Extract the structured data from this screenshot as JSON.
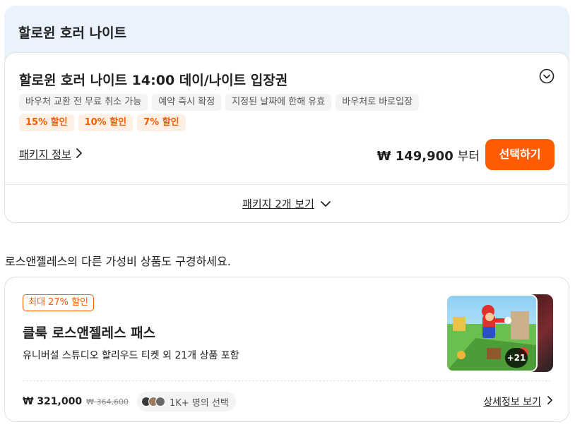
{
  "section": {
    "title": "할로윈 호러 나이트"
  },
  "package": {
    "title": "할로윈 호러 나이트 14:00 데이/나이트 입장권",
    "info_tags": [
      "바우처 교환 전 무료 취소 가능",
      "예약 즉시 확정",
      "지정된 날짜에 한해 유효",
      "바우처로 바로입장"
    ],
    "discount_tags": [
      "15% 할인",
      "10% 할인",
      "7% 할인"
    ],
    "info_link": "패키지 정보",
    "price": "₩ 149,900",
    "price_suffix": "부터",
    "select_button": "선택하기",
    "more_packages": "패키지 2개 보기",
    "icons": {
      "collapse": "chevron-up-circle-icon",
      "info_chevron": "chevron-right-icon",
      "more_chevron": "chevron-down-icon"
    }
  },
  "recommendation": {
    "heading": "로스앤젤레스의 다른 가성비 상품도 구경하세요."
  },
  "product": {
    "badge": "최대 27% 할인",
    "title": "클룩 로스앤젤레스 패스",
    "description": "유니버설 스튜디오 할리우드 티켓 외 21개 상품 포함",
    "image_count": "+21",
    "price": "₩ 321,000",
    "original_price": "₩ 364,600",
    "chosen_text": "1K+ 명의 선택",
    "detail_link": "상세정보 보기"
  },
  "colors": {
    "accent": "#ff5b00",
    "section_bg": "#eaf2fd",
    "tag_bg": "#f3f3f3",
    "discount_tag_bg": "#fff0e6"
  }
}
